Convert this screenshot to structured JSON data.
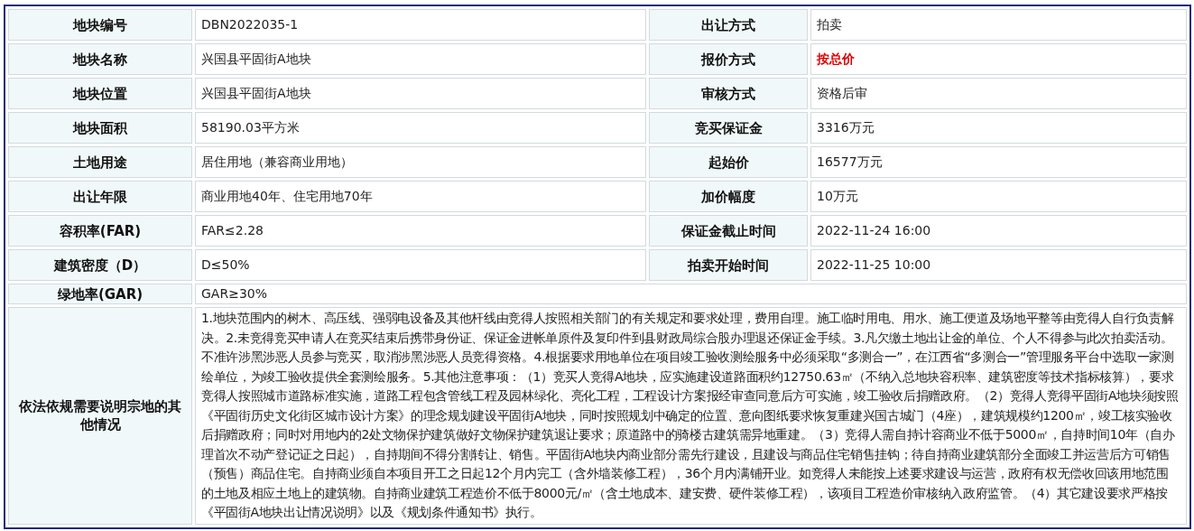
{
  "rows": [
    {
      "fields": [
        {
          "label": "地块编号",
          "value": "DBN2022035-1"
        },
        {
          "label": "出让方式",
          "value": "拍卖"
        }
      ]
    },
    {
      "fields": [
        {
          "label": "地块名称",
          "value": "兴国县平固街A地块"
        },
        {
          "label": "报价方式",
          "value": "按总价",
          "highlight": true
        }
      ]
    },
    {
      "fields": [
        {
          "label": "地块位置",
          "value": "兴国县平固街A地块"
        },
        {
          "label": "审核方式",
          "value": "资格后审"
        }
      ]
    },
    {
      "fields": [
        {
          "label": "地块面积",
          "value": "58190.03平方米"
        },
        {
          "label": "竞买保证金",
          "value": "3316万元"
        }
      ]
    },
    {
      "fields": [
        {
          "label": "土地用途",
          "value": "居住用地（兼容商业用地）"
        },
        {
          "label": "起始价",
          "value": "16577万元"
        }
      ]
    },
    {
      "fields": [
        {
          "label": "出让年限",
          "value": "商业用地40年、住宅用地70年"
        },
        {
          "label": "加价幅度",
          "value": "10万元"
        }
      ]
    },
    {
      "fields": [
        {
          "label": "容积率(FAR)",
          "value": "FAR≤2.28"
        },
        {
          "label": "保证金截止时间",
          "value": "2022-11-24 16:00"
        }
      ]
    },
    {
      "fields": [
        {
          "label": "建筑密度（D）",
          "value": "D≤50%"
        },
        {
          "label": "拍卖开始时间",
          "value": "2022-11-25 10:00"
        }
      ]
    },
    {
      "fields": [
        {
          "label": "绿地率(GAR)",
          "value": "GAR≥30%"
        }
      ]
    },
    {
      "fields": [
        {
          "label": "依法依规需要说明宗地的其他情况",
          "value": "1.地块范围内的树木、高压线、强弱电设备及其他杆线由竞得人按照相关部门的有关规定和要求处理，费用自理。施工临时用电、用水、施工便道及场地平整等由竞得人自行负责解决。2.未竞得竞买申请人在竞买结束后携带身份证、保证金进帐单原件及复印件到县财政局综合股办理退还保证金手续。3.凡欠缴土地出让金的单位、个人不得参与此次拍卖活动。不准许涉黑涉恶人员参与竞买，取消涉黑涉恶人员竞得资格。4.根据要求用地单位在项目竣工验收测绘服务中必须采取“多测合一”，在江西省“多测合一”管理服务平台中选取一家测绘单位，为竣工验收提供全套测绘服务。5.其他注意事项：（1）竞买人竞得A地块，应实施建设道路面积约12750.63㎡（不纳入总地块容积率、建筑密度等技术指标核算），要求竞得人按照城市道路标准实施，道路工程包含管线工程及园林绿化、亮化工程，工程设计方案报经审查同意后方可实施，竣工验收后捐赠政府。（2）竞得人竞得平固街A地块须按照《平固街历史文化街区城市设计方案》的理念规划建设平固街A地块，同时按照规划中确定的位置、意向图纸要求恢复重建兴国古城门（4座），建筑规模约1200㎡，竣工核实验收后捐赠政府；同时对用地内的2处文物保护建筑做好文物保护建筑退让要求；原道路中的骑楼古建筑需异地重建。（3）竞得人需自持计容商业不低于5000㎡，自持时间10年（自办理首次不动产登记证之日起），自持期间不得分割转让、销售。平固街A地块内商业部分需先行建设，且建设与商品住宅销售挂钩；待自持商业建筑部分全面竣工并运营后方可销售（预售）商品住宅。自持商业须自本项目开工之日起12个月内完工（含外墙装修工程），36个月内满铺开业。如竞得人未能按上述要求建设与运营，政府有权无偿收回该用地范围的土地及相应土地上的建筑物。自持商业建筑工程造价不低于8000元/㎡（含土地成本、建安费、硬件装修工程），该项目工程造价审核纳入政府监管。（4）其它建设要求严格按《平固街A地块出让情况说明》以及《规划条件通知书》执行。"
        }
      ]
    }
  ]
}
